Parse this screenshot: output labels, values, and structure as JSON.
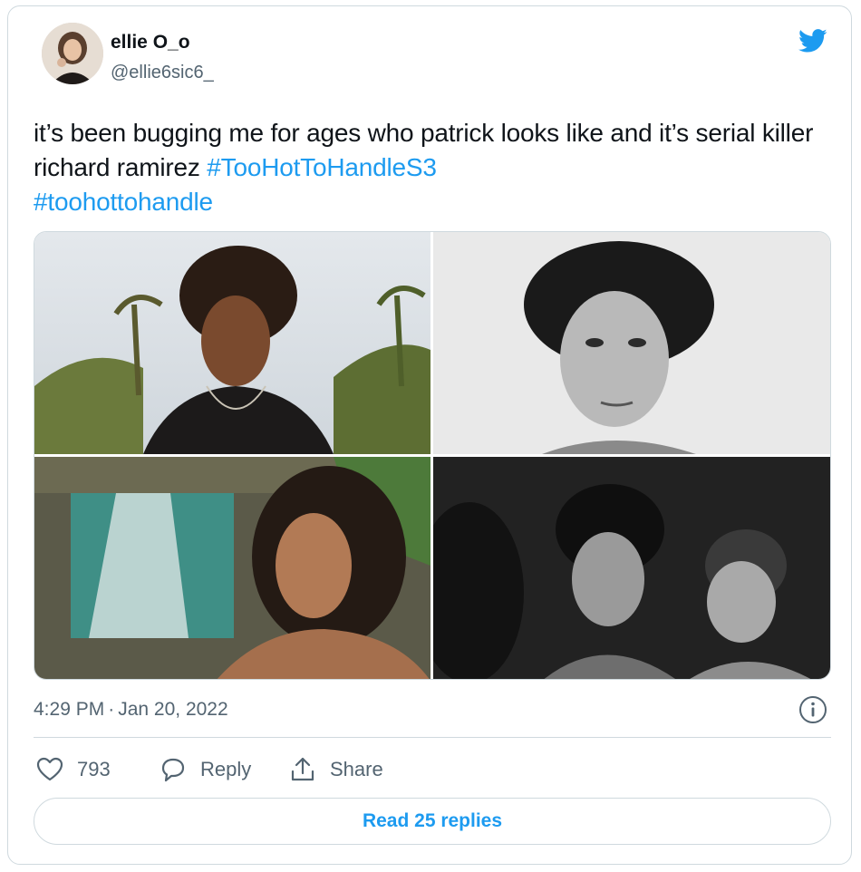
{
  "author": {
    "name": "ellie O_o",
    "handle": "@ellie6sic6_"
  },
  "tweet": {
    "text_plain": "it’s been bugging me for ages who patrick looks like and it’s serial killer richard ramirez ",
    "hashtag_1": "#TooHotToHandleS3",
    "hashtag_2": "#toohottohandle"
  },
  "timestamp": {
    "time": "4:29 PM",
    "separator": "·",
    "date": "Jan 20, 2022"
  },
  "actions": {
    "like_count": "793",
    "reply_label": "Reply",
    "share_label": "Share"
  },
  "read_replies_label": "Read 25 replies",
  "colors": {
    "accent": "#1d9bf0",
    "secondary_text": "#536471",
    "border": "#cfd9de"
  },
  "icons": [
    "twitter-bird-icon",
    "info-icon",
    "heart-icon",
    "reply-bubble-icon",
    "share-icon"
  ]
}
